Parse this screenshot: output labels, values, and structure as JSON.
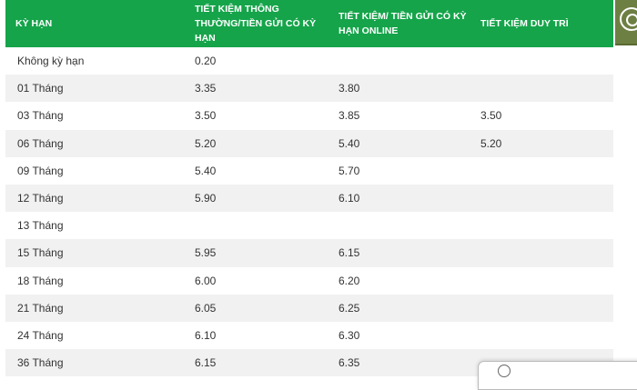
{
  "table": {
    "headers": [
      "Kỳ hạn",
      "Tiết kiệm thông thường/Tiền gửi có kỳ hạn",
      "Tiết kiệm/ Tiền gửi có kỳ hạn online",
      "Tiết kiệm duy trì"
    ],
    "rows": [
      [
        "Không kỳ hạn",
        "0.20",
        "",
        ""
      ],
      [
        "01 Tháng",
        "3.35",
        "3.80",
        ""
      ],
      [
        "03 Tháng",
        "3.50",
        "3.85",
        "3.50"
      ],
      [
        "06 Tháng",
        "5.20",
        "5.40",
        "5.20"
      ],
      [
        "09 Tháng",
        "5.40",
        "5.70",
        ""
      ],
      [
        "12 Tháng",
        "5.90",
        "6.10",
        ""
      ],
      [
        "13 Tháng",
        "",
        "",
        ""
      ],
      [
        "15 Tháng",
        "5.95",
        "6.15",
        ""
      ],
      [
        "18 Tháng",
        "6.00",
        "6.20",
        ""
      ],
      [
        "21 Tháng",
        "6.05",
        "6.25",
        ""
      ],
      [
        "24 Tháng",
        "6.10",
        "6.30",
        ""
      ],
      [
        "36 Tháng",
        "6.15",
        "6.35",
        ""
      ]
    ]
  },
  "colors": {
    "header_bg": "#15a44a",
    "row_alt_bg": "#f1f1f1",
    "logo_bg": "#6e7f43"
  },
  "icons": {
    "corner_logo": "circular-logo-icon",
    "popup_button": "circle-button-icon"
  }
}
